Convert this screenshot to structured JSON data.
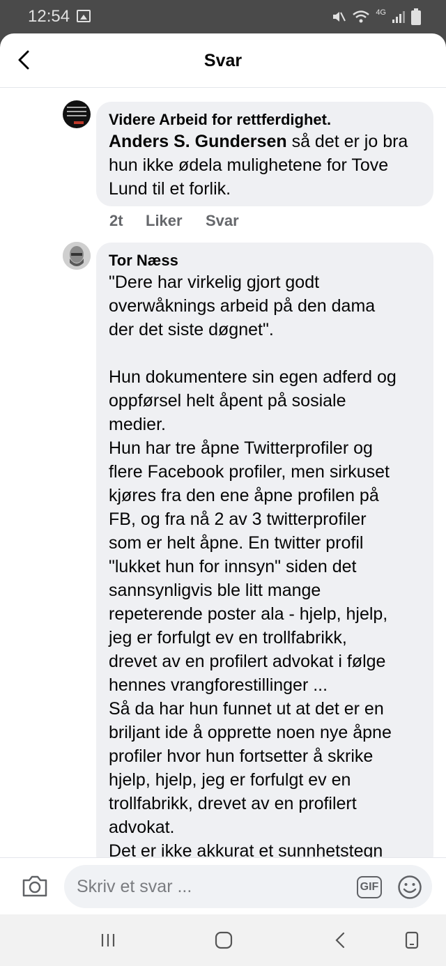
{
  "status_bar": {
    "time": "12:54",
    "network": "4G"
  },
  "header": {
    "title": "Svar"
  },
  "comments": [
    {
      "author": "Videre Arbeid for rettferdighet.",
      "mention": "Anders S. Gundersen",
      "text": " så det er jo bra\nhun ikke ødela mulighetene for Tove\nLund til et forlik.",
      "time": "2t",
      "like_label": "Liker",
      "reply_label": "Svar"
    },
    {
      "author": "Tor Næss",
      "text": "\"Dere har virkelig gjort godt\noverwåknings arbeid på den dama\nder det siste døgnet\".\n\nHun dokumentere sin egen adferd og\noppførsel helt åpent på sosiale\nmedier.\nHun har tre åpne Twitterprofiler og\nflere Facebook profiler, men sirkuset\nkjøres fra den ene åpne profilen på\nFB, og fra nå 2 av 3 twitterprofiler\nsom er helt åpne. En twitter profil\n\"lukket hun for innsyn\" siden det\nsannsynligvis ble litt mange\nrepeterende poster ala - hjelp, hjelp,\njeg er forfulgt ev en trollfabrikk,\ndrevet av en profilert advokat i følge\nhennes vrangforestillinger ...\nSå da har hun funnet ut at det er en\nbriljant ide å opprette noen nye åpne\nprofiler hvor hun fortsetter å skrike\nhjelp, hjelp, jeg er forfulgt ev en\ntrollfabrikk, drevet av en profilert\nadvokat.\nDet er ikke akkurat et sunnhetstegn"
    }
  ],
  "composer": {
    "placeholder": "Skriv et svar ...",
    "gif_label": "GIF"
  }
}
